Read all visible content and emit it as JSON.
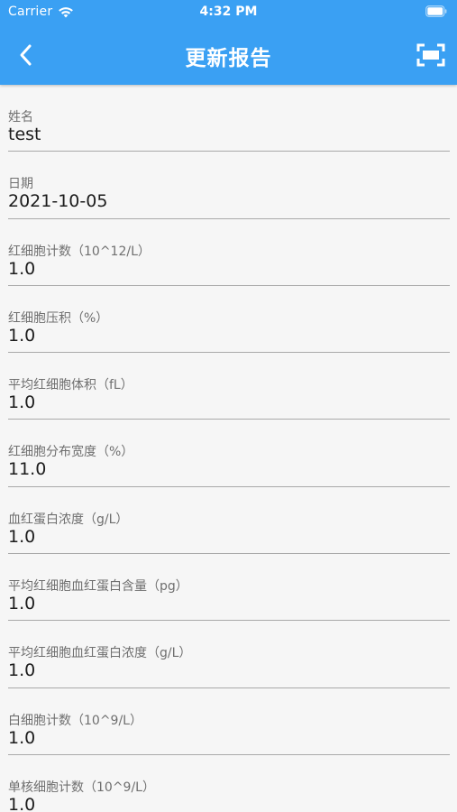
{
  "status_bar": {
    "carrier": "Carrier",
    "time": "4:32 PM"
  },
  "app_bar": {
    "title": "更新报告",
    "back_icon": "chevron-left-icon",
    "scan_icon": "scan-frame-icon"
  },
  "colors": {
    "primary": "#3aa0f3",
    "background": "#f6f6f6",
    "label": "#6f6f6f",
    "value": "#1c1c1c",
    "divider": "#a9a9a9"
  },
  "fields": [
    {
      "label": "姓名",
      "value": "test"
    },
    {
      "label": "日期",
      "value": "2021-10-05"
    },
    {
      "label": "红细胞计数（10^12/L）",
      "value": "1.0"
    },
    {
      "label": "红细胞压积（%）",
      "value": "1.0"
    },
    {
      "label": "平均红细胞体积（fL）",
      "value": "1.0"
    },
    {
      "label": "红细胞分布宽度（%）",
      "value": "11.0"
    },
    {
      "label": "血红蛋白浓度（g/L）",
      "value": "1.0"
    },
    {
      "label": "平均红细胞血红蛋白含量（pg）",
      "value": "1.0"
    },
    {
      "label": "平均红细胞血红蛋白浓度（g/L）",
      "value": "1.0"
    },
    {
      "label": "白细胞计数（10^9/L）",
      "value": "1.0"
    },
    {
      "label": "单核细胞计数（10^9/L）",
      "value": "1.0"
    }
  ]
}
